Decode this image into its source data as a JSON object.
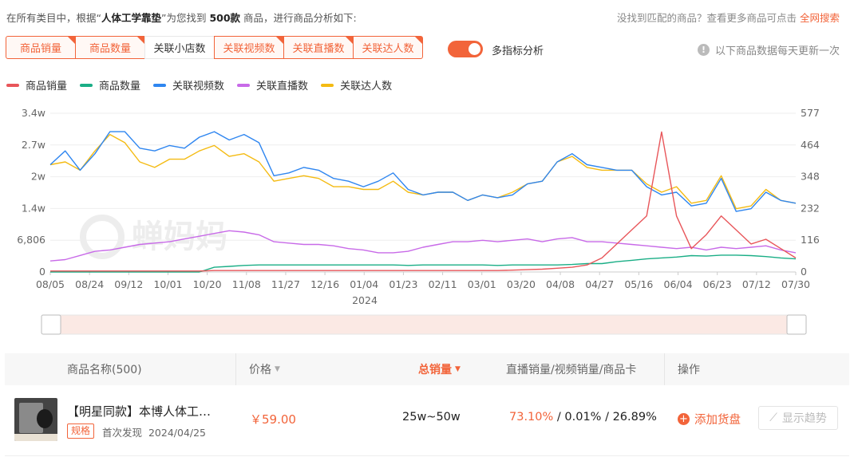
{
  "header": {
    "prefix": "在所有类目中，根据“",
    "keyword": "人体工学靠垫",
    "middle": "”为您找到",
    "count": "500款",
    "suffix": "商品，进行商品分析如下:",
    "right_text": "没找到匹配的商品？查看更多商品可点击",
    "right_link": "全网搜索"
  },
  "tabs": [
    {
      "label": "商品销量",
      "active": true
    },
    {
      "label": "商品数量",
      "active": true
    },
    {
      "label": "关联小店数",
      "active": false
    },
    {
      "label": "关联视频数",
      "active": true
    },
    {
      "label": "关联直播数",
      "active": true
    },
    {
      "label": "关联达人数",
      "active": true
    }
  ],
  "toggle": {
    "label": "多指标分析",
    "on": true
  },
  "update_note": "以下商品数据每天更新一次",
  "chart_data": {
    "type": "line",
    "series": [
      {
        "name": "商品销量",
        "color": "#e8565a"
      },
      {
        "name": "商品数量",
        "color": "#1aae86"
      },
      {
        "name": "关联视频数",
        "color": "#2f86f0"
      },
      {
        "name": "关联直播数",
        "color": "#c86ae8"
      },
      {
        "name": "关联达人数",
        "color": "#f4bb13"
      }
    ],
    "x_ticks": [
      "08/05",
      "08/24",
      "09/12",
      "10/01",
      "10/20",
      "11/08",
      "11/27",
      "12/16",
      "01/04",
      "01/23",
      "02/11",
      "03/01",
      "03/20",
      "04/08",
      "04/27",
      "05/16",
      "06/04",
      "06/23",
      "07/12",
      "07/30"
    ],
    "year_label": "2024",
    "y_left_ticks": [
      "0",
      "6,806",
      "1.4w",
      "2w",
      "2.7w",
      "3.4w"
    ],
    "y_right_ticks": [
      "0",
      "116",
      "232",
      "348",
      "464",
      "577"
    ],
    "y_left_range": [
      0,
      34000
    ],
    "y_right_range": [
      0,
      577
    ],
    "values": {
      "关联视频数": [
        390,
        440,
        370,
        430,
        510,
        510,
        450,
        440,
        460,
        450,
        490,
        510,
        480,
        500,
        470,
        350,
        360,
        380,
        370,
        340,
        330,
        310,
        330,
        360,
        300,
        280,
        290,
        290,
        260,
        280,
        270,
        280,
        320,
        330,
        400,
        430,
        390,
        380,
        370,
        370,
        310,
        280,
        290,
        240,
        250,
        340,
        220,
        230,
        290,
        260,
        250
      ],
      "关联达人数": [
        390,
        400,
        370,
        440,
        500,
        470,
        400,
        380,
        410,
        410,
        440,
        460,
        420,
        430,
        400,
        330,
        340,
        350,
        340,
        310,
        310,
        300,
        300,
        330,
        290,
        280,
        290,
        290,
        260,
        280,
        270,
        290,
        320,
        330,
        400,
        420,
        380,
        370,
        370,
        370,
        320,
        290,
        310,
        250,
        260,
        350,
        230,
        240,
        300,
        260,
        250
      ],
      "关联直播数": [
        40,
        45,
        60,
        75,
        80,
        90,
        100,
        105,
        110,
        120,
        130,
        140,
        150,
        145,
        135,
        110,
        105,
        100,
        100,
        95,
        85,
        80,
        70,
        70,
        75,
        90,
        100,
        110,
        110,
        115,
        110,
        115,
        120,
        110,
        120,
        125,
        110,
        110,
        105,
        100,
        95,
        90,
        85,
        90,
        80,
        90,
        85,
        90,
        95,
        80,
        70
      ],
      "商品数量": [
        0,
        0,
        0,
        0,
        0,
        0,
        0,
        0,
        0,
        0,
        0,
        1000,
        1200,
        1400,
        1500,
        1500,
        1500,
        1500,
        1500,
        1500,
        1500,
        1500,
        1500,
        1500,
        1400,
        1500,
        1500,
        1500,
        1500,
        1500,
        1400,
        1500,
        1500,
        1500,
        1500,
        1600,
        1800,
        1800,
        2200,
        2500,
        2800,
        3000,
        3200,
        3500,
        3400,
        3600,
        3600,
        3500,
        3300,
        3000,
        2800
      ],
      "商品销量": [
        200,
        200,
        200,
        200,
        200,
        200,
        200,
        200,
        200,
        200,
        200,
        300,
        300,
        300,
        300,
        300,
        300,
        300,
        300,
        300,
        300,
        300,
        300,
        300,
        300,
        300,
        300,
        300,
        300,
        300,
        300,
        400,
        500,
        600,
        800,
        1000,
        1500,
        3000,
        6000,
        9000,
        12000,
        30000,
        12000,
        5000,
        8000,
        12000,
        9000,
        6000,
        7000,
        5000,
        3000
      ]
    }
  },
  "table": {
    "headers": {
      "name": "商品名称(500)",
      "price": "价格",
      "sales": "总销量",
      "ratio": "直播销量/视频销量/商品卡",
      "action": "操作"
    },
    "rows": [
      {
        "name": "【明星同款】本博人体工…",
        "badge": "规格",
        "first_seen_label": "首次发现",
        "first_seen_date": "2024/04/25",
        "price": "￥59.00",
        "sales": "25w~50w",
        "ratio_live": "73.10%",
        "ratio_rest": "/ 0.01% / 26.89%",
        "add_label": "添加货盘",
        "trend_label": "显示趋势"
      }
    ]
  },
  "watermark": "蝉妈妈"
}
